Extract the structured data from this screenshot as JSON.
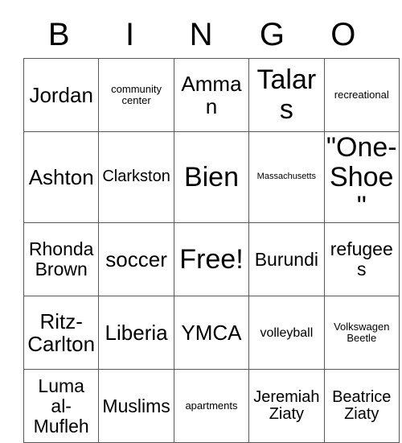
{
  "card": {
    "title": "BINGO",
    "header_letters": [
      "B",
      "I",
      "N",
      "G",
      "O"
    ],
    "free_space_label": "Free!",
    "grid_line_color": "#595959",
    "text_color": "#000000",
    "background_color": "#ffffff",
    "rows": [
      [
        {
          "label": "Jordan",
          "size": "fs-xl"
        },
        {
          "label": "community center",
          "size": "fs-xs"
        },
        {
          "label": "Amman",
          "size": "fs-xl"
        },
        {
          "label": "Talars",
          "size": "fs-xxl"
        },
        {
          "label": "recreational",
          "size": "fs-xs"
        }
      ],
      [
        {
          "label": "Ashton",
          "size": "fs-xl"
        },
        {
          "label": "Clarkston",
          "size": "fs-m"
        },
        {
          "label": "Bien",
          "size": "fs-xxl"
        },
        {
          "label": "Massachusetts",
          "size": "fs-xxs"
        },
        {
          "label": "\"One-Shoe\"",
          "size": "fs-xxl"
        }
      ],
      [
        {
          "label": "Rhonda Brown",
          "size": "fs-l"
        },
        {
          "label": "soccer",
          "size": "fs-xl"
        },
        {
          "label": "Free!",
          "size": "fs-xxl"
        },
        {
          "label": "Burundi",
          "size": "fs-l"
        },
        {
          "label": "refugees",
          "size": "fs-l"
        }
      ],
      [
        {
          "label": "Ritz-Carlton",
          "size": "fs-xl"
        },
        {
          "label": "Liberia",
          "size": "fs-xl"
        },
        {
          "label": "YMCA",
          "size": "fs-xl"
        },
        {
          "label": "volleyball",
          "size": "fs-s"
        },
        {
          "label": "Volkswagen Beetle",
          "size": "fs-xs"
        }
      ],
      [
        {
          "label": "Luma al-Mufleh",
          "size": "fs-l"
        },
        {
          "label": "Muslims",
          "size": "fs-l"
        },
        {
          "label": "apartments",
          "size": "fs-xs"
        },
        {
          "label": "Jeremiah Ziaty",
          "size": "fs-m"
        },
        {
          "label": "Beatrice Ziaty",
          "size": "fs-m"
        }
      ]
    ]
  }
}
